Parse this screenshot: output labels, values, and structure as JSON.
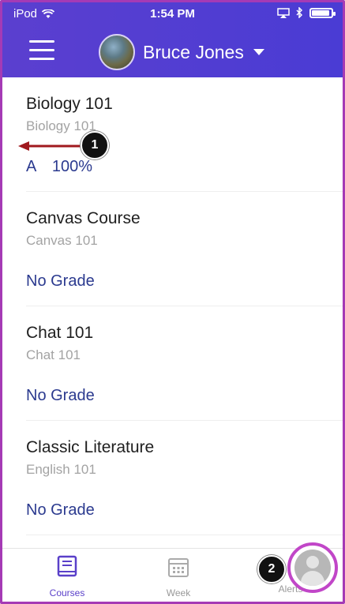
{
  "status_bar": {
    "carrier": "iPod",
    "time": "1:54 PM"
  },
  "header": {
    "user_name": "Bruce Jones"
  },
  "courses": [
    {
      "name": "Biology 101",
      "code": "Biology 101",
      "grade_letter": "A",
      "grade_percent": "100%"
    },
    {
      "name": "Canvas Course",
      "code": "Canvas 101",
      "grade": "No Grade"
    },
    {
      "name": "Chat 101",
      "code": "Chat 101",
      "grade": "No Grade"
    },
    {
      "name": "Classic Literature",
      "code": "English 101",
      "grade": "No Grade"
    }
  ],
  "tabs": [
    {
      "label": "Courses",
      "icon": "courses-book-icon",
      "active": true
    },
    {
      "label": "Week",
      "icon": "calendar-icon",
      "active": false
    },
    {
      "label": "Alerts",
      "icon": "alerts-avatar-icon",
      "active": false
    }
  ],
  "annotations": {
    "badge_1": "1",
    "badge_2": "2"
  },
  "colors": {
    "header": "#5b3fcf",
    "grade_text": "#2b3a8f",
    "highlight": "#c146c8",
    "arrow": "#a0191e"
  }
}
